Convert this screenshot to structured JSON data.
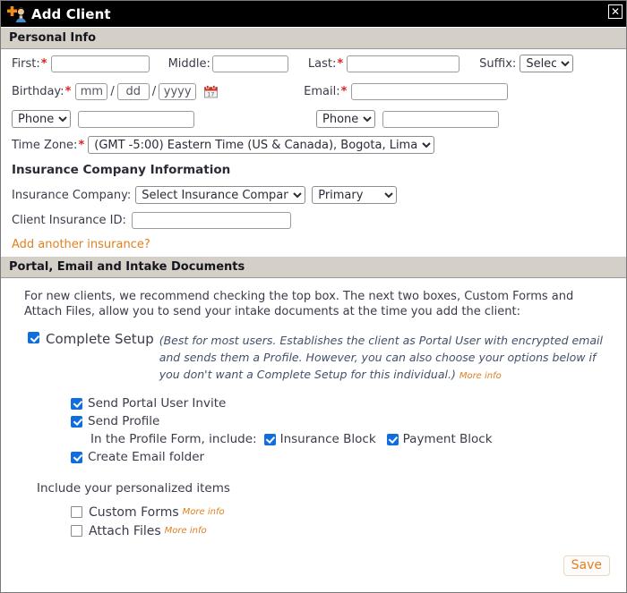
{
  "window": {
    "title": "Add Client",
    "icon": "add-person-icon",
    "close_label": "✕"
  },
  "sections": {
    "personal_info": {
      "heading": "Personal Info",
      "first_label": "First:",
      "first_value": "",
      "middle_label": "Middle:",
      "middle_value": "",
      "last_label": "Last:",
      "last_value": "",
      "suffix_label": "Suffix:",
      "suffix_value": "Select",
      "birthday_label": "Birthday:",
      "birthday_mm": "mm",
      "birthday_dd": "dd",
      "birthday_yyyy": "yyyy",
      "slash": "/",
      "calendar_icon": "calendar-icon",
      "email_label": "Email:",
      "email_value": "",
      "phone_left_type": "Phone",
      "phone_left_value": "",
      "phone_right_type": "Phone",
      "phone_right_value": "",
      "timezone_label": "Time Zone:",
      "timezone_value": "(GMT -5:00) Eastern Time (US & Canada), Bogota, Lima",
      "required_mark": "*"
    },
    "insurance": {
      "heading": "Insurance Company Information",
      "company_label": "Insurance Company:",
      "company_value": "Select Insurance Company",
      "priority_value": "Primary",
      "client_id_label": "Client Insurance ID:",
      "client_id_value": "",
      "add_another_link": "Add another insurance?"
    },
    "portal": {
      "heading": "Portal, Email and Intake Documents",
      "intro": "For new clients, we recommend checking the top box. The next two boxes, Custom Forms and Attach Files, allow you to send your intake documents at the time you add the client:",
      "complete_setup_label": "Complete Setup",
      "complete_setup_checked": true,
      "complete_setup_desc": "(Best for most users. Establishes the client as Portal User with encrypted email and sends them a Profile. However, you can also choose your options below if you don't want a Complete Setup for this individual.)",
      "more_info": "More info",
      "send_portal_invite_label": "Send Portal User Invite",
      "send_portal_invite_checked": true,
      "send_profile_label": "Send Profile",
      "send_profile_checked": true,
      "profile_include_label": "In the Profile Form, include:",
      "insurance_block_label": "Insurance Block",
      "insurance_block_checked": true,
      "payment_block_label": "Payment Block",
      "payment_block_checked": true,
      "create_email_folder_label": "Create Email folder",
      "create_email_folder_checked": true,
      "personalized_label": "Include your personalized items",
      "custom_forms_label": "Custom Forms",
      "custom_forms_checked": false,
      "attach_files_label": "Attach Files",
      "attach_files_checked": false,
      "save_label": "Save"
    }
  },
  "colors": {
    "accent_orange": "#e08020",
    "checkbox_blue": "#0f6ddd",
    "required_red": "#e02020",
    "section_bar": "#d4d0c8",
    "titlebar": "#000000"
  }
}
